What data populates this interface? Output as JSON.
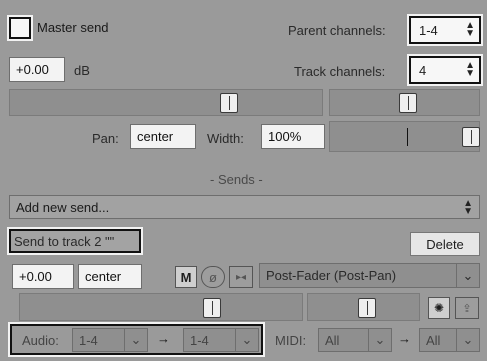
{
  "master": {
    "checkbox_checked": false,
    "label": "Master send"
  },
  "parent_channels": {
    "label": "Parent channels:",
    "value": "1-4"
  },
  "volume": {
    "value": "+0.00",
    "unit": "dB"
  },
  "track_channels": {
    "label": "Track channels:",
    "value": "4"
  },
  "pan": {
    "label": "Pan:",
    "value": "center"
  },
  "width": {
    "label": "Width:",
    "value": "100%"
  },
  "sends": {
    "header": "- Sends -",
    "add_new": "Add new send..."
  },
  "send": {
    "name": "Send to track 2 \"\"",
    "delete_label": "Delete",
    "volume": "+0.00",
    "pan": "center",
    "mute_label": "M",
    "mode": "Post-Fader (Post-Pan)"
  },
  "routing": {
    "audio_label": "Audio:",
    "audio_src": "1-4",
    "arrow": "→",
    "audio_dst": "1-4",
    "midi_label": "MIDI:",
    "midi_src": "All",
    "midi_dst": "All"
  },
  "colors": {
    "panel": "#9a9a9a",
    "field": "#f3f3f3",
    "track": "#8f8f8f",
    "highlight": "#111111"
  },
  "icons": [
    "checkbox-icon",
    "spin-arrows-icon",
    "phase-invert-icon",
    "mono-icon",
    "pan-law-icon",
    "envelope-icon",
    "chevron-down-icon",
    "arrow-right-icon"
  ]
}
